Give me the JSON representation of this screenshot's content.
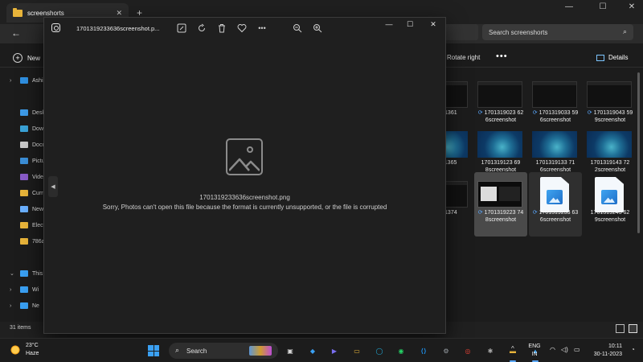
{
  "explorer": {
    "tab_title": "screenshorts",
    "tab_close": "✕",
    "new_tab": "+",
    "minimize": "—",
    "maximize": "☐",
    "close": "✕",
    "back": "←",
    "search_placeholder": "Search screenshorts",
    "new_label": "New",
    "rotate_right": "Rotate right",
    "more": "•••",
    "details": "Details",
    "status_items": "31 items",
    "nav": [
      {
        "label": "Ashis",
        "color": "#2f8fe0"
      },
      {
        "label": "Desk",
        "color": "#3d9be9"
      },
      {
        "label": "Dow",
        "color": "#3aa3d8"
      },
      {
        "label": "Docu",
        "color": "#c9c9c9"
      },
      {
        "label": "Pictu",
        "color": "#3b8fd8"
      },
      {
        "label": "Video",
        "color": "#8a5cc9"
      },
      {
        "label": "Curre",
        "color": "#e8b43a"
      },
      {
        "label": "New",
        "color": "#6ab0ff"
      },
      {
        "label": "Elect",
        "color": "#e8b43a"
      },
      {
        "label": "786a",
        "color": "#e8b43a"
      },
      {
        "label": "This",
        "color": "#3aa0f3"
      },
      {
        "label": "Wi",
        "color": "#3aa0f3"
      },
      {
        "label": "Ne",
        "color": "#3aa0f3"
      }
    ],
    "tiles": [
      {
        "name": "1901361",
        "kind": "dark",
        "sync": false
      },
      {
        "name": "1701319023 62\n6screenshot",
        "kind": "dark",
        "sync": true
      },
      {
        "name": "1701319033 59\n6screenshot",
        "kind": "dark",
        "sync": true
      },
      {
        "name": "1701319043 59\n9screenshot",
        "kind": "dark",
        "sync": true
      },
      {
        "name": "1911365",
        "kind": "ocean",
        "sync": false
      },
      {
        "name": "1701319123 69\n8screenshot",
        "kind": "ocean",
        "sync": false
      },
      {
        "name": "1701319133 71\n6screenshot",
        "kind": "ocean",
        "sync": false
      },
      {
        "name": "1701319143 72\n2screenshot",
        "kind": "ocean",
        "sync": false
      },
      {
        "name": "1921374",
        "kind": "dark",
        "sync": false
      },
      {
        "name": "1701319223 74\n8screenshot",
        "kind": "sshot",
        "sync": true
      },
      {
        "name": "1701319233 63\n6screenshot",
        "kind": "file",
        "sync": true
      },
      {
        "name": "1701319243 62\n9screenshot",
        "kind": "file",
        "sync": false
      }
    ]
  },
  "photos": {
    "title": "1701319233636screenshot.p...",
    "minimize": "—",
    "maximize": "☐",
    "close": "✕",
    "prev": "◀",
    "filename": "1701319233636screenshot.png",
    "error": "Sorry, Photos can't open this file because the format is currently unsupported, or the file is corrupted",
    "tools": [
      "edit-icon",
      "rotate-icon",
      "delete-icon",
      "favorite-icon",
      "more-icon",
      "zoom-out-icon",
      "zoom-in-icon"
    ]
  },
  "taskbar": {
    "temp": "23°C",
    "condition": "Haze",
    "search": "Search",
    "lang_top": "ENG",
    "lang_bottom": "IN",
    "time": "10:11",
    "date": "30-11-2023",
    "tray_chevron": "^",
    "apps": [
      {
        "name": "task-view-icon",
        "color": "#d8d8d8"
      },
      {
        "name": "copilot-icon",
        "color": "#3aa0f3"
      },
      {
        "name": "meet-icon",
        "color": "#7a6ff0"
      },
      {
        "name": "files-icon",
        "color": "#e8b43a"
      },
      {
        "name": "alexa-icon",
        "color": "#21b6e8"
      },
      {
        "name": "whatsapp-icon",
        "color": "#25d366"
      },
      {
        "name": "vscode-icon",
        "color": "#1d8ee8"
      },
      {
        "name": "settings-icon",
        "color": "#9aa0a6"
      },
      {
        "name": "chrome-icon",
        "color": "#e94235"
      },
      {
        "name": "gear-icon",
        "color": "#aaaaaa"
      },
      {
        "name": "explorer-icon",
        "color": "#e8b43a"
      },
      {
        "name": "photos-icon",
        "color": "#3fa4f0"
      }
    ]
  }
}
